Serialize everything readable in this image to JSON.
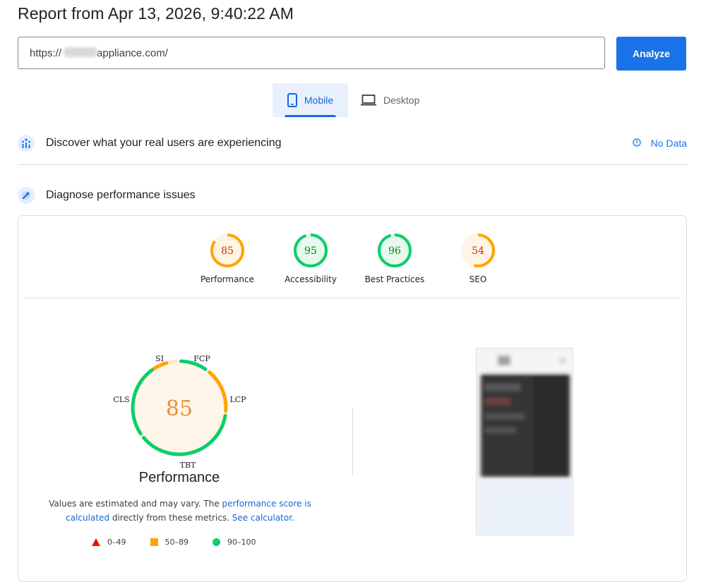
{
  "header": {
    "title": "Report from Apr 13, 2026, 9:40:22 AM"
  },
  "search": {
    "url_prefix": "https://",
    "url_suffix": "appliance.com/",
    "analyze_label": "Analyze"
  },
  "tabs": [
    {
      "label": "Mobile",
      "icon": "smartphone-icon",
      "active": true
    },
    {
      "label": "Desktop",
      "icon": "laptop-icon",
      "active": false
    }
  ],
  "field_data": {
    "title": "Discover what your real users are experiencing",
    "status": "No Data",
    "icon": "users-chart-icon"
  },
  "lab": {
    "title": "Diagnose performance issues",
    "icon": "diagnose-icon"
  },
  "categories": [
    {
      "name": "Performance",
      "score": "85",
      "score_value": 85,
      "status": "average"
    },
    {
      "name": "Accessibility",
      "score": "95",
      "score_value": 95,
      "status": "pass"
    },
    {
      "name": "Best Practices",
      "score": "96",
      "score_value": 96,
      "status": "pass"
    },
    {
      "name": "SEO",
      "score": "54",
      "score_value": 54,
      "status": "average"
    }
  ],
  "performance": {
    "score": "85",
    "title": "Performance",
    "metric_labels": {
      "si": "SI",
      "fcp": "FCP",
      "lcp": "LCP",
      "tbt": "TBT",
      "cls": "CLS"
    },
    "note_start": "Values are estimated and may vary. The ",
    "note_link": "performance score is calculated",
    "note_mid": " directly from these metrics. ",
    "note_link2": "See calculator."
  },
  "legend": [
    {
      "range": "0–49",
      "shape": "triangle",
      "color": "#eb0f00"
    },
    {
      "range": "50–89",
      "shape": "square",
      "color": "#ffa400"
    },
    {
      "range": "90–100",
      "shape": "circle",
      "color": "#0cce6b"
    }
  ],
  "colors": {
    "pass": "#0cce6b",
    "pass_bg": "#e6f9ee",
    "pass_text": "#008800",
    "average": "#ffa400",
    "average_bg": "#fff4e5",
    "average_text": "#c33300",
    "accent": "#1a73e8"
  }
}
